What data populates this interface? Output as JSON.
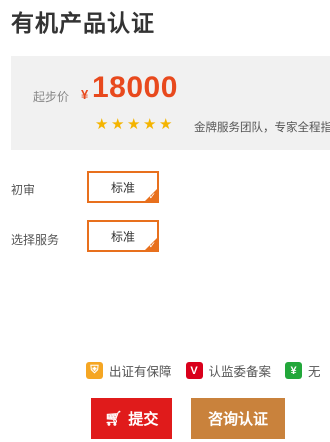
{
  "page": {
    "title": "有机产品认证"
  },
  "price": {
    "prefix": "起步价",
    "currency": "¥",
    "amount": "18000",
    "rating_stars": 5,
    "tagline": "金牌服务团队，专家全程指导"
  },
  "options": [
    {
      "label": "初审",
      "value": "标准"
    },
    {
      "label": "选择服务",
      "value": "标准"
    }
  ],
  "guarantees": [
    {
      "icon": "shield-icon",
      "text": "出证有保障"
    },
    {
      "icon": "v-badge-icon",
      "text": "认监委备案"
    },
    {
      "icon": "yen-icon",
      "text": "无"
    }
  ],
  "actions": {
    "submit_label": "提交",
    "consult_label": "咨询认证"
  },
  "colors": {
    "accent_orange": "#e8491d",
    "option_border": "#e8701d",
    "submit_bg": "#e01b1b",
    "consult_bg": "#c9823c",
    "star": "#f4b400"
  }
}
